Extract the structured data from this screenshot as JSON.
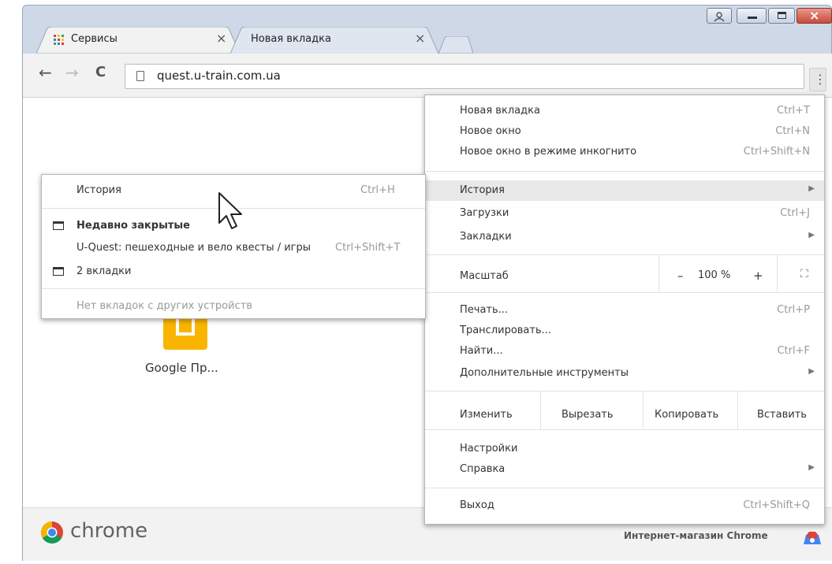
{
  "tabs": [
    {
      "title": "Сервисы",
      "close": "×",
      "active": true
    },
    {
      "title": "Новая вкладка",
      "close": "×",
      "active": false
    }
  ],
  "window_controls": {
    "user": "user-icon",
    "minimize": "minimize-icon",
    "maximize": "maximize-icon",
    "close": "×"
  },
  "toolbar": {
    "back": "←",
    "forward": "→",
    "reload": "C",
    "url": "quest.u-train.com.ua",
    "menu": "⋮"
  },
  "main_menu": {
    "new_tab": {
      "label": "Новая вкладка",
      "shortcut": "Ctrl+T"
    },
    "new_window": {
      "label": "Новое окно",
      "shortcut": "Ctrl+N"
    },
    "incognito": {
      "label": "Новое окно в режиме инкогнито",
      "shortcut": "Ctrl+Shift+N"
    },
    "history": {
      "label": "История",
      "arrow": "▶"
    },
    "downloads": {
      "label": "Загрузки",
      "shortcut": "Ctrl+J"
    },
    "bookmarks": {
      "label": "Закладки",
      "arrow": "▶"
    },
    "zoom": {
      "label": "Масштаб",
      "minus": "–",
      "value": "100 %",
      "plus": "+",
      "fullscreen": "⛶"
    },
    "print": {
      "label": "Печать...",
      "shortcut": "Ctrl+P"
    },
    "cast": {
      "label": "Транслировать..."
    },
    "find": {
      "label": "Найти...",
      "shortcut": "Ctrl+F"
    },
    "more_tools": {
      "label": "Дополнительные инструменты",
      "arrow": "▶"
    },
    "edit": {
      "label": "Изменить",
      "cut": "Вырезать",
      "copy": "Копировать",
      "paste": "Вставить"
    },
    "settings": {
      "label": "Настройки"
    },
    "help": {
      "label": "Справка",
      "arrow": "▶"
    },
    "exit": {
      "label": "Выход",
      "shortcut": "Ctrl+Shift+Q"
    }
  },
  "history_submenu": {
    "history": {
      "label": "История",
      "shortcut": "Ctrl+H"
    },
    "recently_closed": {
      "label": "Недавно закрытые"
    },
    "recent_item": {
      "label": "U-Quest: пешеходные и вело квесты / игры",
      "shortcut": "Ctrl+Shift+T"
    },
    "two_tabs": {
      "label": "2 вкладки"
    },
    "no_tabs": {
      "label": "Нет вкладок с других устройств"
    }
  },
  "content": {
    "app_label": "Google Пр..."
  },
  "footer": {
    "brand": "chrome",
    "store_link": "Интернет-магазин Chrome"
  },
  "colors": {
    "window_frame": "#cfd8e6",
    "close_button": "#c94a3c",
    "highlight": "#e8e8e8",
    "app_tile": "#f9b400"
  }
}
